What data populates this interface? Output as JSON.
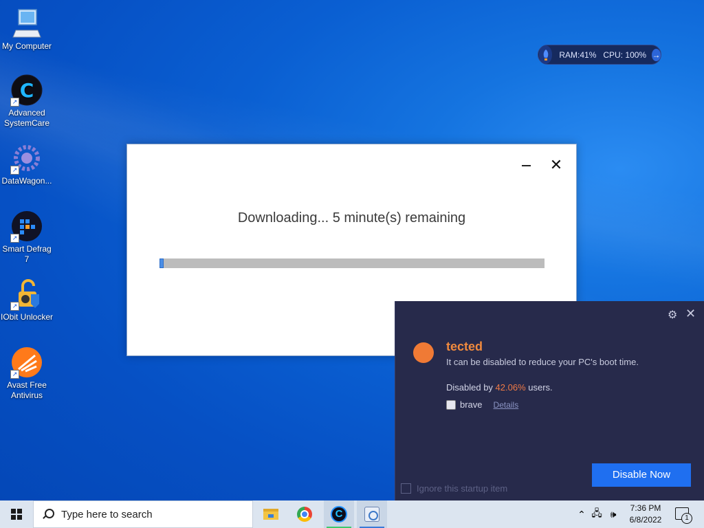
{
  "desktop": {
    "icons": [
      {
        "label": "My Computer",
        "icon": "computer-icon"
      },
      {
        "label": "Advanced SystemCare",
        "icon": "advanced-systemcare-icon"
      },
      {
        "label": "DataWagon...",
        "icon": "datawagon-icon"
      },
      {
        "label": "Smart Defrag 7",
        "icon": "smart-defrag-icon"
      },
      {
        "label": "IObit Unlocker",
        "icon": "iobit-unlocker-icon"
      },
      {
        "label": "Avast Free Antivirus",
        "icon": "avast-icon"
      }
    ]
  },
  "sysmon": {
    "ram": "RAM:41%",
    "cpu": "CPU: 100%"
  },
  "download_dialog": {
    "status": "Downloading... 5 minute(s) remaining",
    "progress_percent": 1,
    "minimize_icon": "minimize-icon",
    "close_icon": "close-icon"
  },
  "startup_panel": {
    "heading": "tected",
    "subtext": "It can be disabled to reduce your PC's boot time.",
    "disabled_by_prefix": "Disabled by ",
    "disabled_by_pct": "42.06%",
    "disabled_by_suffix": " users.",
    "app_name": "brave",
    "details_link": "Details",
    "disable_button": "Disable Now",
    "ignore_label": "Ignore this startup item",
    "colors": {
      "accent": "#f07a35",
      "button": "#1f6ff0",
      "bg": "#272a4b"
    }
  },
  "taskbar": {
    "search_placeholder": "Type here to search",
    "apps": [
      "file-explorer-icon",
      "chrome-icon",
      "advanced-systemcare-icon",
      "setup-icon"
    ],
    "time": "7:36 PM",
    "date": "6/8/2022",
    "notification_count": "1"
  }
}
